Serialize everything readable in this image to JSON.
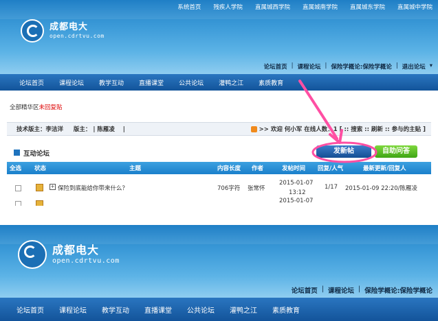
{
  "top_links": [
    "系统首页",
    "残疾人学院",
    "直属城西学院",
    "直属城南学院",
    "直属城东学院",
    "直属城中学院"
  ],
  "logo": {
    "name": "成都电大",
    "sub": "open.cdrtvu.com"
  },
  "subnav": {
    "items": [
      "论坛首页",
      "课程论坛",
      "保险学概论:保险学概论"
    ],
    "logout": "退出论坛"
  },
  "nav": [
    "论坛首页",
    "课程论坛",
    "教学互动",
    "直播课堂",
    "公共论坛",
    "灌鸭之江",
    "素质教育"
  ],
  "breadcrumb": {
    "prefix": "全部精华区",
    "highlight": "未回复贴"
  },
  "moderators": {
    "tech_label": "技术版主：",
    "tech_name": "李洁洋",
    "mod_label": "版主：",
    "mod_sep": "|",
    "mod_name": "陈雁凌",
    "trail_sep": "|",
    "welcome": ">> 欢迎 何小军 在线人数：1 [ :: 搜索 :: 刷新 :: 参与的主贴 ]"
  },
  "forum": {
    "title": "互动论坛",
    "new_post_button": "发新帖",
    "ask_button": "自助问答",
    "columns": [
      "全选",
      "状态",
      "主题",
      "内容长度",
      "作者",
      "发帖时间",
      "回复/人气",
      "最新更新/回复人"
    ],
    "rows": [
      {
        "subject": "保险到底能给你带来什么？",
        "length": "706字符",
        "author": "张常怀",
        "date": "2015-01-07",
        "time": "13:12",
        "replies": "1/17",
        "last": "2015-01-09 22:20/陈雁凌"
      },
      {
        "date": "2015-01-07"
      }
    ]
  },
  "colors": {
    "header_top": "#1f7fc6",
    "nav": "#13549a",
    "accent_pink": "#ff4fa3",
    "new_post": "#154f94",
    "ask": "#3ea515"
  }
}
